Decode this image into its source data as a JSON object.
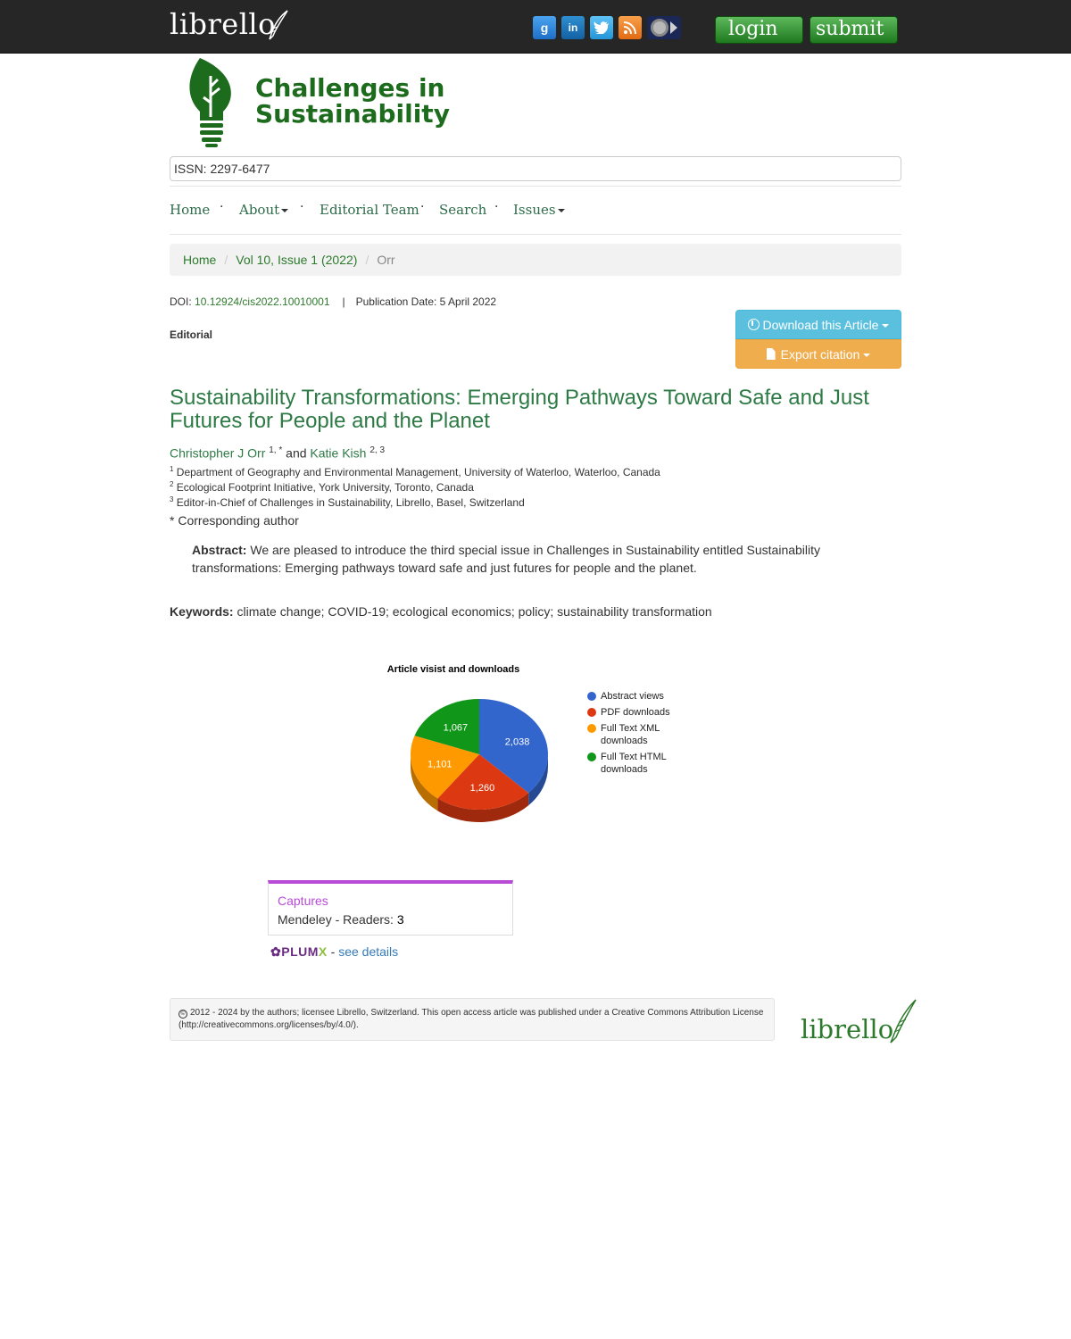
{
  "topbar": {
    "brand": "librello",
    "social": [
      "google-icon",
      "linkedin-icon",
      "twitter-icon",
      "rss-icon",
      "archive-icon"
    ],
    "login_label": "login",
    "submit_label": "submit"
  },
  "journal": {
    "title_line1": "Challenges in",
    "title_line2": "Sustainability",
    "issn": "ISSN: 2297-6477"
  },
  "nav": {
    "home": "Home",
    "about": "About",
    "editorial_team": "Editorial Team",
    "search": "Search",
    "issues": "Issues",
    "separator": "·"
  },
  "breadcrumb": {
    "home": "Home",
    "issue": "Vol 10, Issue 1 (2022)",
    "current": "Orr",
    "sep": "/"
  },
  "meta": {
    "doi_label": "DOI:",
    "doi": "10.12924/cis2022.10010001",
    "pipe": "|",
    "publication": "Publication Date: 5 April 2022",
    "article_type": "Editorial"
  },
  "buttons": {
    "download": "Download this Article",
    "export": "Export citation"
  },
  "article": {
    "title": "Sustainability Transformations: Emerging Pathways Toward Safe and Just Futures for People and the Planet",
    "author1": "Christopher J Orr",
    "author1_sup": "1, *",
    "and": "and",
    "author2": "Katie Kish",
    "author2_sup": "2, 3",
    "affiliations": [
      {
        "num": "1",
        "text": "Department of Geography and Environmental Management, University of Waterloo, Waterloo, Canada"
      },
      {
        "num": "2",
        "text": "Ecological Footprint Initiative, York University, Toronto, Canada"
      },
      {
        "num": "3",
        "text": "Editor-in-Chief of Challenges in Sustainability, Librello, Basel, Switzerland"
      }
    ],
    "corr_mark": "*",
    "corr_text": "Corresponding author",
    "abstract_label": "Abstract:",
    "abstract": "We are pleased to introduce the third special issue in Challenges in Sustainability entitled Sustainability transformations: Emerging pathways toward safe and just futures for people and the planet.",
    "keywords_label": "Keywords:",
    "keywords": "climate change; COVID-19; ecological economics; policy; sustainability transformation"
  },
  "chart_data": {
    "type": "pie",
    "title": "Article visist and downloads",
    "categories": [
      "Abstract views",
      "PDF downloads",
      "Full Text XML downloads",
      "Full Text HTML downloads"
    ],
    "values": [
      2038,
      1260,
      1101,
      1067
    ],
    "labels": [
      "2,038",
      "1,260",
      "1,101",
      "1,067"
    ],
    "colors": [
      "#3366cc",
      "#dc3912",
      "#ff9900",
      "#109618"
    ],
    "legend_position": "right",
    "style": "3d"
  },
  "captures": {
    "title": "Captures",
    "readers_label": "Mendeley - Readers:",
    "readers_value": "3"
  },
  "plumx": {
    "logo_main": "PLUM",
    "logo_x": "X",
    "dash": "-",
    "details": "see details"
  },
  "footer": {
    "license": "2012 - 2024 by the authors; licensee Librello, Switzerland. This open access article was published under a Creative Commons Attribution License (http://creativecommons.org/licenses/by/4.0/).",
    "brand": "librello",
    "copyright_symbol": "©"
  }
}
